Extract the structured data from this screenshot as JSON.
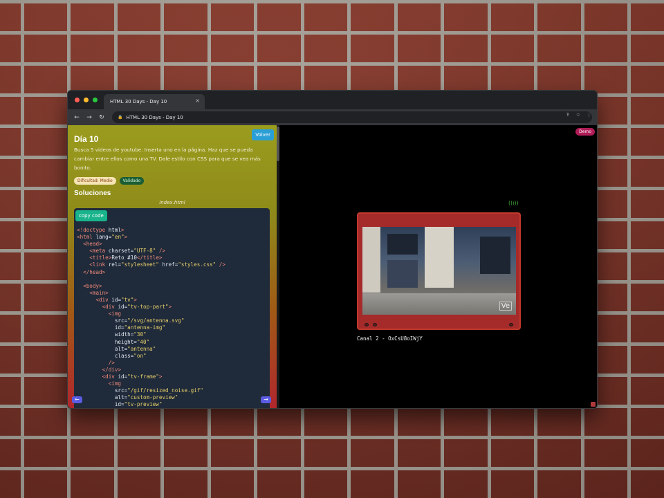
{
  "browser": {
    "tab_title": "HTML 30 Days - Day 10",
    "tab_close": "×",
    "url": "HTML 30 Days - Day 10",
    "nav": {
      "back": "←",
      "forward": "→",
      "reload": "↻",
      "lock": "🔒"
    },
    "right_icons": {
      "share": "⇪",
      "star": "☆",
      "menu": "⋮"
    }
  },
  "sidebar": {
    "back_button": "Volver",
    "title": "Día 10",
    "description": "Busca 5 videos de youtube. Inserta uno en la página. Haz que se pueda cambiar entre ellos como una TV. Dale estilo con CSS para que se vea más bonito.",
    "badges": {
      "difficulty": "Dificultad: Medio",
      "status": "Validado"
    },
    "solutions_heading": "Soluciones",
    "file_name": "index.html",
    "copy_button": "copy code",
    "code_lines": [
      "<!doctype html>",
      "<html lang=\"en\">",
      "  <head>",
      "    <meta charset=\"UTF-8\" />",
      "    <title>Reto #10</title>",
      "    <link rel=\"stylesheet\" href=\"styles.css\" />",
      "  </head>",
      "",
      "  <body>",
      "    <main>",
      "      <div id=\"tv\">",
      "        <div id=\"tv-top-part\">",
      "          <img",
      "            src=\"/svg/antenna.svg\"",
      "            id=\"antenna-img\"",
      "            width=\"30\"",
      "            height=\"40\"",
      "            alt=\"antenna\"",
      "            class=\"on\"",
      "          />",
      "        </div>",
      "        <div id=\"tv-frame\">",
      "          <img",
      "            src=\"/gif/resized_noise.gif\"",
      "            alt=\"custom-preview\"",
      "            id=\"tv-preview\""
    ],
    "prev_button": "←",
    "next_button": "→"
  },
  "preview": {
    "demo_badge": "Demo",
    "antenna_glyph": "((ı))",
    "screen_logo": "Ve",
    "caption": "Canal 2 - OxCsU8oIWjY"
  },
  "colors": {
    "tv_body": "#a52a2a",
    "copy_button": "#19b48b",
    "volver_button": "#2a9fd6",
    "demo_badge": "#b01d57"
  }
}
